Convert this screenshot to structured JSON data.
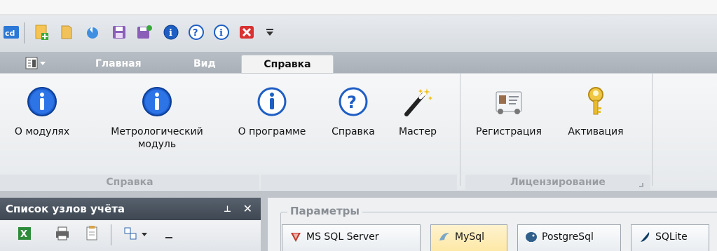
{
  "quick_access": {
    "icons": [
      "app-logo-icon",
      "new-file-icon",
      "open-folder-icon",
      "refresh-icon",
      "save-icon",
      "save-as-icon",
      "info-icon",
      "help-icon",
      "about-icon",
      "close-red-icon",
      "customize-dropdown-icon"
    ]
  },
  "tabs": {
    "menu_button": "",
    "items": [
      {
        "label": "Главная"
      },
      {
        "label": "Вид"
      },
      {
        "label": "Справка"
      }
    ]
  },
  "ribbon": {
    "groups": [
      {
        "label": "Справка",
        "buttons": [
          {
            "label_line1": "О модулях",
            "label_line2": ""
          },
          {
            "label_line1": "Метрологический",
            "label_line2": "модуль"
          },
          {
            "label_line1": "О программе",
            "label_line2": ""
          },
          {
            "label_line1": "Справка",
            "label_line2": ""
          },
          {
            "label_line1": "Мастер",
            "label_line2": ""
          }
        ]
      },
      {
        "label": "Лицензирование",
        "buttons": [
          {
            "label_line1": "Регистрация",
            "label_line2": ""
          },
          {
            "label_line1": "Активация",
            "label_line2": ""
          }
        ]
      }
    ]
  },
  "node_panel": {
    "title": "Список узлов учёта",
    "pin": "⊥",
    "close": "✕"
  },
  "params": {
    "legend": "Параметры",
    "db_tabs": [
      {
        "label": "MS SQL Server"
      },
      {
        "label": "MySql"
      },
      {
        "label": "PostgreSql"
      },
      {
        "label": "SQLite"
      }
    ]
  },
  "colors": {
    "accent_blue": "#1f6fd1",
    "panel_title": "#4a5460",
    "mysql_tab": "#fde8a6"
  }
}
